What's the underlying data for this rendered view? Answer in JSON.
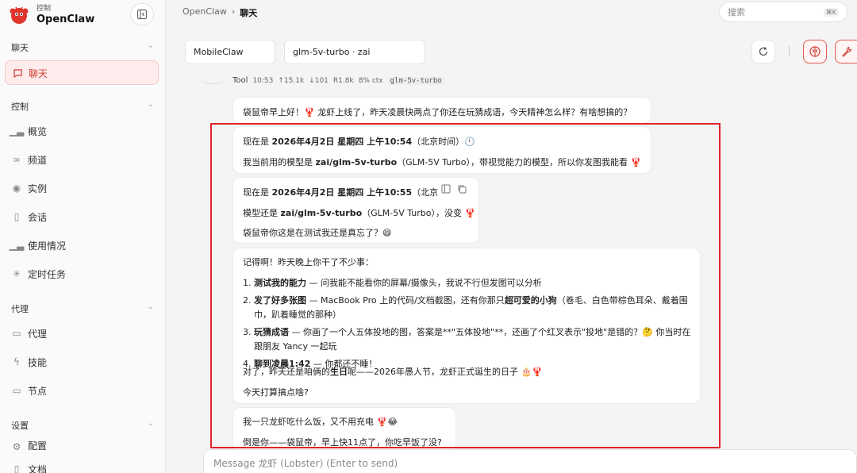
{
  "brand": {
    "sub": "控制",
    "title": "OpenClaw"
  },
  "sidebar": {
    "sections": [
      {
        "title": "聊天"
      },
      {
        "title": "控制"
      },
      {
        "title": "代理"
      },
      {
        "title": "设置"
      }
    ],
    "chat_item": "聊天",
    "control_items": [
      "概览",
      "频道",
      "实例",
      "会话",
      "使用情况",
      "定时任务"
    ],
    "agent_items": [
      "代理",
      "技能",
      "节点"
    ],
    "settings_items": [
      "配置",
      "文档"
    ]
  },
  "breadcrumb": {
    "root": "OpenClaw",
    "sep": "›",
    "current": "聊天"
  },
  "search": {
    "placeholder": "搜索",
    "shortcut": "⌘K"
  },
  "toolbar": {
    "session": "MobileClaw",
    "model": "glm-5v-turbo · zai"
  },
  "meta": {
    "sender": "Tool",
    "time": "10:53",
    "up": "↑15.1k",
    "down": "↓101",
    "r": "R1.8k",
    "ctx": "8% ctx",
    "model": "glm-5v-turbo"
  },
  "messages": {
    "m1": "袋鼠帝早上好！🦞 龙虾上线了，昨天凌晨快两点了你还在玩猜成语，今天精神怎么样？有啥想搞的？",
    "m2_l1_pre": "现在是 ",
    "m2_l1_bold": "2026年4月2日 星期四 上午10:54",
    "m2_l1_post": "（北京时间）🕚",
    "m2_l2_pre": "我当前用的模型是 ",
    "m2_l2_bold": "zai/glm-5v-turbo",
    "m2_l2_post": "（GLM-5V Turbo），带视觉能力的模型，所以你发图我能看 🦞",
    "m3_l1_pre": "现在是 ",
    "m3_l1_bold": "2026年4月2日 星期四 上午10:55",
    "m3_l1_post": "（北京",
    "m3_l2_pre": "模型还是 ",
    "m3_l2_bold": "zai/glm-5v-turbo",
    "m3_l2_post": "（GLM-5V Turbo），没变 🦞",
    "m3_l3": "袋鼠帝你这是在测试我还是真忘了？😄",
    "m4_intro": "记得啊！昨天晚上你干了不少事：",
    "m4_items": [
      {
        "num": "1.",
        "bold": "测试我的能力",
        "text": " — 问我能不能看你的屏幕/摄像头，我说不行但发图可以分析"
      },
      {
        "num": "2.",
        "bold": "发了好多张图",
        "text": " — MacBook Pro 上的代码/文档截图，还有你那只",
        "bold2": "超可爱的小狗",
        "text2": "（卷毛、白色带棕色耳朵、戴着围巾，趴着睡觉的那种）"
      },
      {
        "num": "3.",
        "bold": "玩猜成语",
        "text": " — 你画了一个人五体投地的图，答案是**\"五体投地\"**，还画了个红叉表示\"投地\"是错的？🤔 你当时在跟朋友 Yancy 一起玩"
      },
      {
        "num": "4.",
        "bold": "聊到凌晨1:42",
        "text": " — 你都还不睡！"
      }
    ],
    "m4_l5_pre": "对了，昨天还是咱俩的",
    "m4_l5_bold": "生日",
    "m4_l5_post": "呢——2026年愚人节，龙虾正式诞生的日子 🎂🦞",
    "m4_l6": "今天打算搞点啥?",
    "m5_l1": "我一只龙虾吃什么饭，又不用充电 🦞😂",
    "m5_l2": "倒是你——袋鼠帝，早上快11点了，你吃早饭了没?"
  },
  "composer": {
    "placeholder": "Message 龙虾 (Lobster) (Enter to send)"
  },
  "colors": {
    "accent": "#d03a32",
    "highlight_box": "#e0242a"
  }
}
